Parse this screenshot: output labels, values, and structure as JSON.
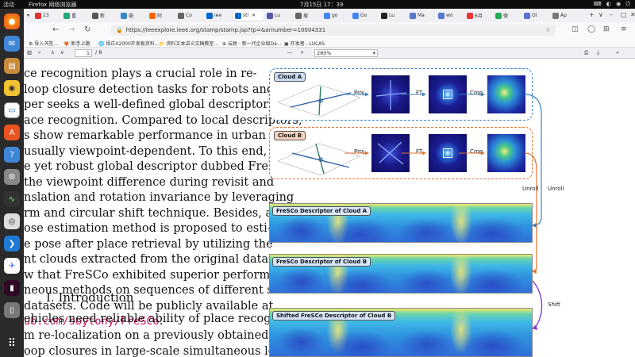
{
  "system": {
    "activities": "活动",
    "app_name": "Firefox 网络浏览器",
    "clock": "7月15日  17：39"
  },
  "tabs": [
    {
      "label": "23",
      "color": "#d33"
    },
    {
      "label": "重",
      "color": "#2a7"
    },
    {
      "label": "新",
      "color": "#555"
    },
    {
      "label": "毫",
      "color": "#38c"
    },
    {
      "label": "阿",
      "color": "#f60"
    },
    {
      "label": "Co",
      "color": "#666"
    },
    {
      "label": "iee",
      "color": "#06c"
    },
    {
      "label": "stl",
      "color": "#06c",
      "active": true
    },
    {
      "label": "Lu",
      "color": "#55a"
    },
    {
      "label": "搜",
      "color": "#666"
    },
    {
      "label": "go",
      "color": "#4285f4"
    },
    {
      "label": "Go",
      "color": "#4285f4"
    },
    {
      "label": "Lu",
      "color": "#222"
    },
    {
      "label": "Ma",
      "color": "#57c"
    },
    {
      "label": "wo",
      "color": "#57c"
    },
    {
      "label": "6月",
      "color": "#e33"
    },
    {
      "label": "微",
      "color": "#2a5"
    },
    {
      "label": "Ol",
      "color": "#57c"
    },
    {
      "label": "Ap",
      "color": "#777"
    }
  ],
  "nav": {
    "url": "https://ieeexplore.ieee.org/stamp/stamp.jsp?tp=&arnumber=10004331"
  },
  "bookmarks": [
    {
      "label": "导入书签..."
    },
    {
      "label": "新手上路"
    },
    {
      "label": "悟正X2000开发板资料..."
    },
    {
      "label": "资料文本讲义文稿教室..."
    },
    {
      "label": "云致 · 新一代企业级De..."
    },
    {
      "label": "开发者 - LUCAS"
    }
  ],
  "pdf": {
    "page": "1",
    "total": "/ 8",
    "zoom": "280%"
  },
  "paper": {
    "lines": [
      "ce recognition plays a crucial role in re-",
      " loop closure detection tasks for robots and",
      "per seeks a well-defined global descriptor for",
      "ace recognition. Compared to local descriptors,",
      "s show remarkable performance in urban road",
      "usually viewpoint-dependent. To this end, we",
      "e yet robust global descriptor dubbed FreSCo",
      " the viewpoint difference during revisit and",
      "nslation and rotation invariance by leveraging",
      "rm and circular shift technique. Besides, a",
      "ose estimation method is proposed to esti-",
      "e pose after place retrieval by utilizing the",
      "nt clouds extracted from the original data.",
      "w that FreSCo exhibited superior performance",
      "neous methods on sequences of different scenes",
      "datasets. Code will be publicly available at"
    ],
    "link_text": "ub.com/soytony/FreSCo",
    "link_tail": ".",
    "section_heading": "I. Introduction",
    "lines2": [
      "ehicles need reliable ability of place recog-",
      "m re-localization on a previously obtained",
      "oop closures in large-scale simultaneous lo-"
    ]
  },
  "figure": {
    "cloud_a": "Cloud A",
    "cloud_b": "Cloud B",
    "proj": "Proj.",
    "ft": "FT",
    "crop": "Crop",
    "unroll": "Unroll",
    "shift": "Shift",
    "desc_a": "FreSCo Descriptor of Cloud A",
    "desc_b": "FreSCo Descriptor of Cloud B",
    "desc_shift": "Shifted FreSCo Descriptor of Cloud B",
    "colors": {
      "cloud_a": "#3b82c4",
      "cloud_b": "#e0732b",
      "shift_arrow": "#8a3cd6"
    }
  }
}
